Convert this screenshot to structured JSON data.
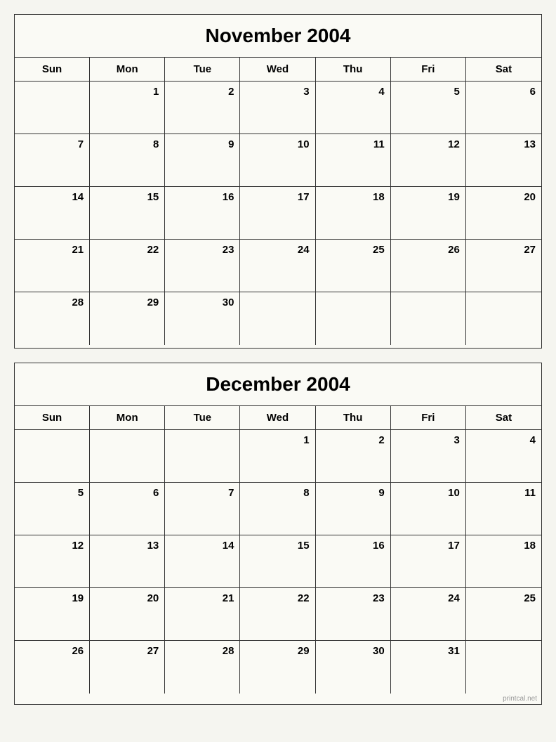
{
  "november": {
    "title": "November 2004",
    "headers": [
      "Sun",
      "Mon",
      "Tue",
      "Wed",
      "Thu",
      "Fri",
      "Sat"
    ],
    "weeks": [
      [
        null,
        1,
        2,
        3,
        4,
        5,
        6
      ],
      [
        7,
        8,
        9,
        10,
        11,
        12,
        13
      ],
      [
        14,
        15,
        16,
        17,
        18,
        19,
        20
      ],
      [
        21,
        22,
        23,
        24,
        25,
        26,
        27
      ],
      [
        28,
        29,
        30,
        null,
        null,
        null,
        null
      ]
    ]
  },
  "december": {
    "title": "December 2004",
    "headers": [
      "Sun",
      "Mon",
      "Tue",
      "Wed",
      "Thu",
      "Fri",
      "Sat"
    ],
    "weeks": [
      [
        null,
        null,
        null,
        1,
        2,
        3,
        4
      ],
      [
        5,
        6,
        7,
        8,
        9,
        10,
        11
      ],
      [
        12,
        13,
        14,
        15,
        16,
        17,
        18
      ],
      [
        19,
        20,
        21,
        22,
        23,
        24,
        25
      ],
      [
        26,
        27,
        28,
        29,
        30,
        31,
        null
      ]
    ]
  },
  "watermark": "printcal.net"
}
